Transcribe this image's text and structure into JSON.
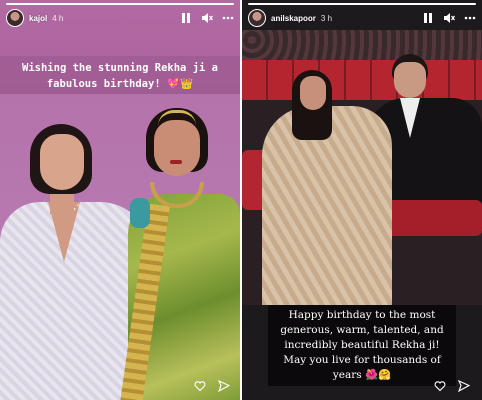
{
  "stories": [
    {
      "username": "kajol",
      "time": "4 h",
      "progress": 1.0,
      "caption": "Wishing the stunning Rekha ji a fabulous birthday! 💖👑",
      "icons": [
        "avatar",
        "pause-icon",
        "mute-icon",
        "more-icon",
        "heart-icon",
        "send-icon"
      ]
    },
    {
      "username": "anilskapoor",
      "time": "3 h",
      "progress": 1.0,
      "caption": "Happy birthday to the most generous, warm, talented, and incredibly beautiful Rekha ji! May you live for thousands of years 🌺🤗",
      "icons": [
        "avatar",
        "pause-icon",
        "mute-icon",
        "more-icon",
        "heart-icon",
        "send-icon"
      ]
    }
  ],
  "colors": {
    "left_bg": "#b26aa3",
    "caption_left_bg": "#a05c94",
    "right_bg": "#1d1a1e",
    "caption_right_bg": "#0a080a"
  }
}
